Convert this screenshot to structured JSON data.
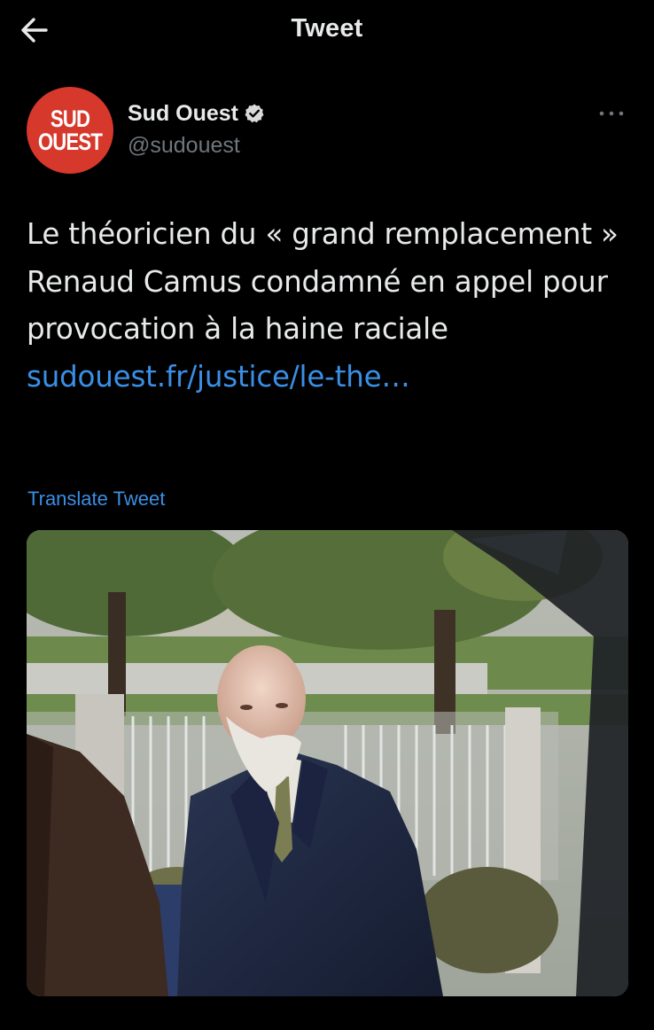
{
  "header": {
    "title": "Tweet",
    "back_icon": "arrow-left-icon"
  },
  "author": {
    "avatar_line1": "SUD",
    "avatar_line2": "OUEST",
    "avatar_color": "#d6382c",
    "display_name": "Sud Ouest",
    "handle": "@sudouest",
    "verified_icon": "verified-badge-icon",
    "more_icon": "more-horizontal-icon"
  },
  "tweet": {
    "text": "Le théoricien du « grand remplacement » Renaud Camus condamné en appel pour provocation à la haine raciale ",
    "link_text": "sudouest.fr/justice/le-the…",
    "translate_label": "Translate Tweet"
  },
  "media": {
    "icon": "photo-icon"
  },
  "colors": {
    "background": "#000000",
    "text": "#e7e9ea",
    "secondary": "#71767b",
    "link": "#3a8fe6"
  }
}
